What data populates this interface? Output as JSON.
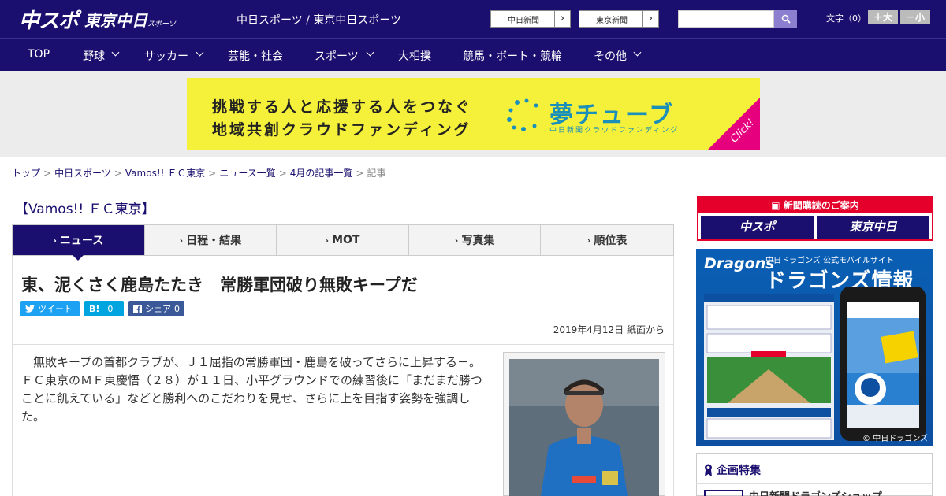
{
  "header": {
    "logo_primary": "中スポ",
    "logo_secondary": "東京中日",
    "logo_secondary_small": "スポーツ",
    "site_title": "中日スポーツ / 東京中日スポーツ",
    "paper_links": [
      {
        "label": "中日新聞"
      },
      {
        "label": "東京新聞"
      }
    ],
    "search": {
      "value": "",
      "placeholder": ""
    },
    "font_size_label": "文字（0）",
    "font_larger": "＋大",
    "font_smaller": "－小"
  },
  "nav": {
    "items": [
      {
        "label": "TOP",
        "dropdown": false
      },
      {
        "label": "野球",
        "dropdown": true
      },
      {
        "label": "サッカー",
        "dropdown": true
      },
      {
        "label": "芸能・社会",
        "dropdown": false
      },
      {
        "label": "スポーツ",
        "dropdown": true
      },
      {
        "label": "大相撲",
        "dropdown": false
      },
      {
        "label": "競馬・ボート・競輪",
        "dropdown": false
      },
      {
        "label": "その他",
        "dropdown": true
      }
    ]
  },
  "banner": {
    "line1": "挑戦する人と応援する人をつなぐ",
    "line2": "地域共創クラウドファンディング",
    "brand": "夢チューブ",
    "brand_sub": "中日新聞クラウドファンディング",
    "click": "Click!"
  },
  "breadcrumb": {
    "items": [
      "トップ",
      "中日スポーツ",
      "Vamos!! ＦＣ東京",
      "ニュース一覧",
      "4月の記事一覧"
    ],
    "current": "記事",
    "separator": ">"
  },
  "section": {
    "title": "【Vamos!! ＦＣ東京】"
  },
  "tabs": [
    {
      "label": "ニュース",
      "active": true
    },
    {
      "label": "日程・結果",
      "active": false
    },
    {
      "label": "MOT",
      "active": false
    },
    {
      "label": "写真集",
      "active": false
    },
    {
      "label": "順位表",
      "active": false
    }
  ],
  "article": {
    "headline": "東、泥くさく鹿島たたき　常勝軍団破り無敗キープだ",
    "share": {
      "tweet": "ツイート",
      "hatena_count": "0",
      "hatena_label": "B!",
      "facebook": "シェア",
      "facebook_count": "0"
    },
    "date": "2019年4月12日 紙面から",
    "body": "無敗キープの首都クラブが、Ｊ１屈指の常勝軍団・鹿島を破ってさらに上昇する－。ＦＣ東京のＭＦ東慶悟（２８）が１１日、小平グラウンドでの練習後に「まだまだ勝つことに飢えている」などと勝利へのこだわりを見せ、さらに上を目指す姿勢を強調した。"
  },
  "sidebar": {
    "subscription": {
      "header": "新聞購読のご案内",
      "logo_a": "中スポ",
      "logo_b": "東京中日"
    },
    "dragons_ad": {
      "logo": "Dragons",
      "subtitle": "中日ドラゴンズ 公式モバイルサイト",
      "title": "ドラゴンズ情報",
      "copyright": "© 中日ドラゴンズ"
    },
    "special": {
      "title": "企画特集",
      "item": "中日新聞ドラゴンズショップ"
    }
  },
  "colors": {
    "brand_navy": "#1a0f6e",
    "banner_yellow": "#f5f13a",
    "accent_red": "#e4002b",
    "twitter": "#1da1f2",
    "hatena": "#00a4de",
    "facebook": "#3b5998"
  }
}
